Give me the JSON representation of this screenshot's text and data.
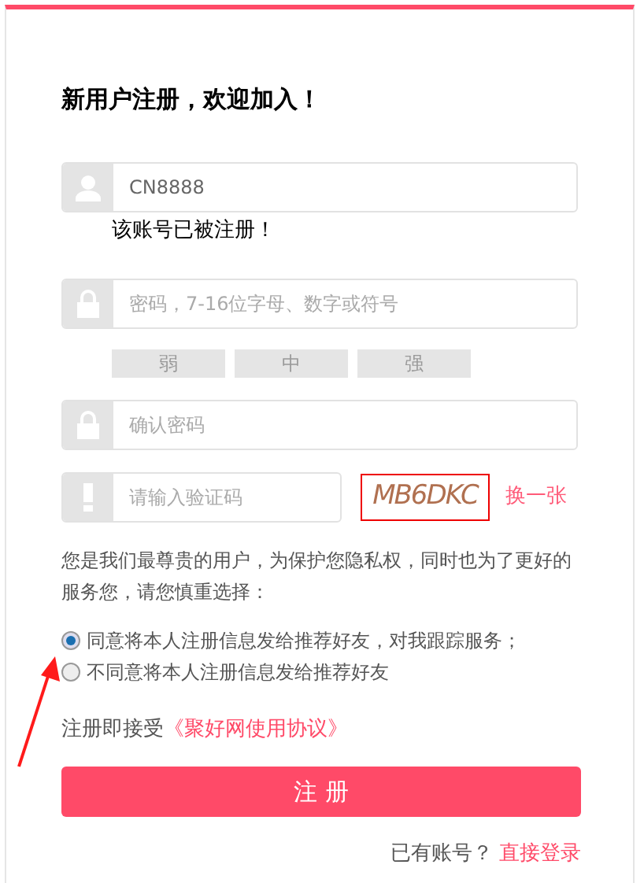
{
  "title": "新用户注册，欢迎加入！",
  "fields": [
    {
      "kind": "user",
      "value": "CN8888",
      "error": "该账号已被注册！"
    },
    {
      "kind": "lock",
      "placeholder": "密码，7-16位字母、数字或符号",
      "strength": [
        "弱",
        "中",
        "强"
      ]
    },
    {
      "kind": "lock",
      "placeholder": "确认密码"
    },
    {
      "kind": "captcha",
      "placeholder": "请输入验证码",
      "captcha": "MB6DKC",
      "refresh": "换一张"
    }
  ],
  "privacy_note": "您是我们最尊贵的用户，为保护您隐私权，同时也为了更好的服务您，请您慎重选择：",
  "options": [
    {
      "label": "同意将本人注册信息发给推荐好友，对我跟踪服务；",
      "selected": true
    },
    {
      "label": "不同意将本人注册信息发给推荐好友",
      "selected": false
    }
  ],
  "agreement": {
    "text": "注册即接受",
    "link": "《聚好网使用协议》"
  },
  "submit": "注 册",
  "login": {
    "text": "已有账号？",
    "link": "直接登录"
  }
}
